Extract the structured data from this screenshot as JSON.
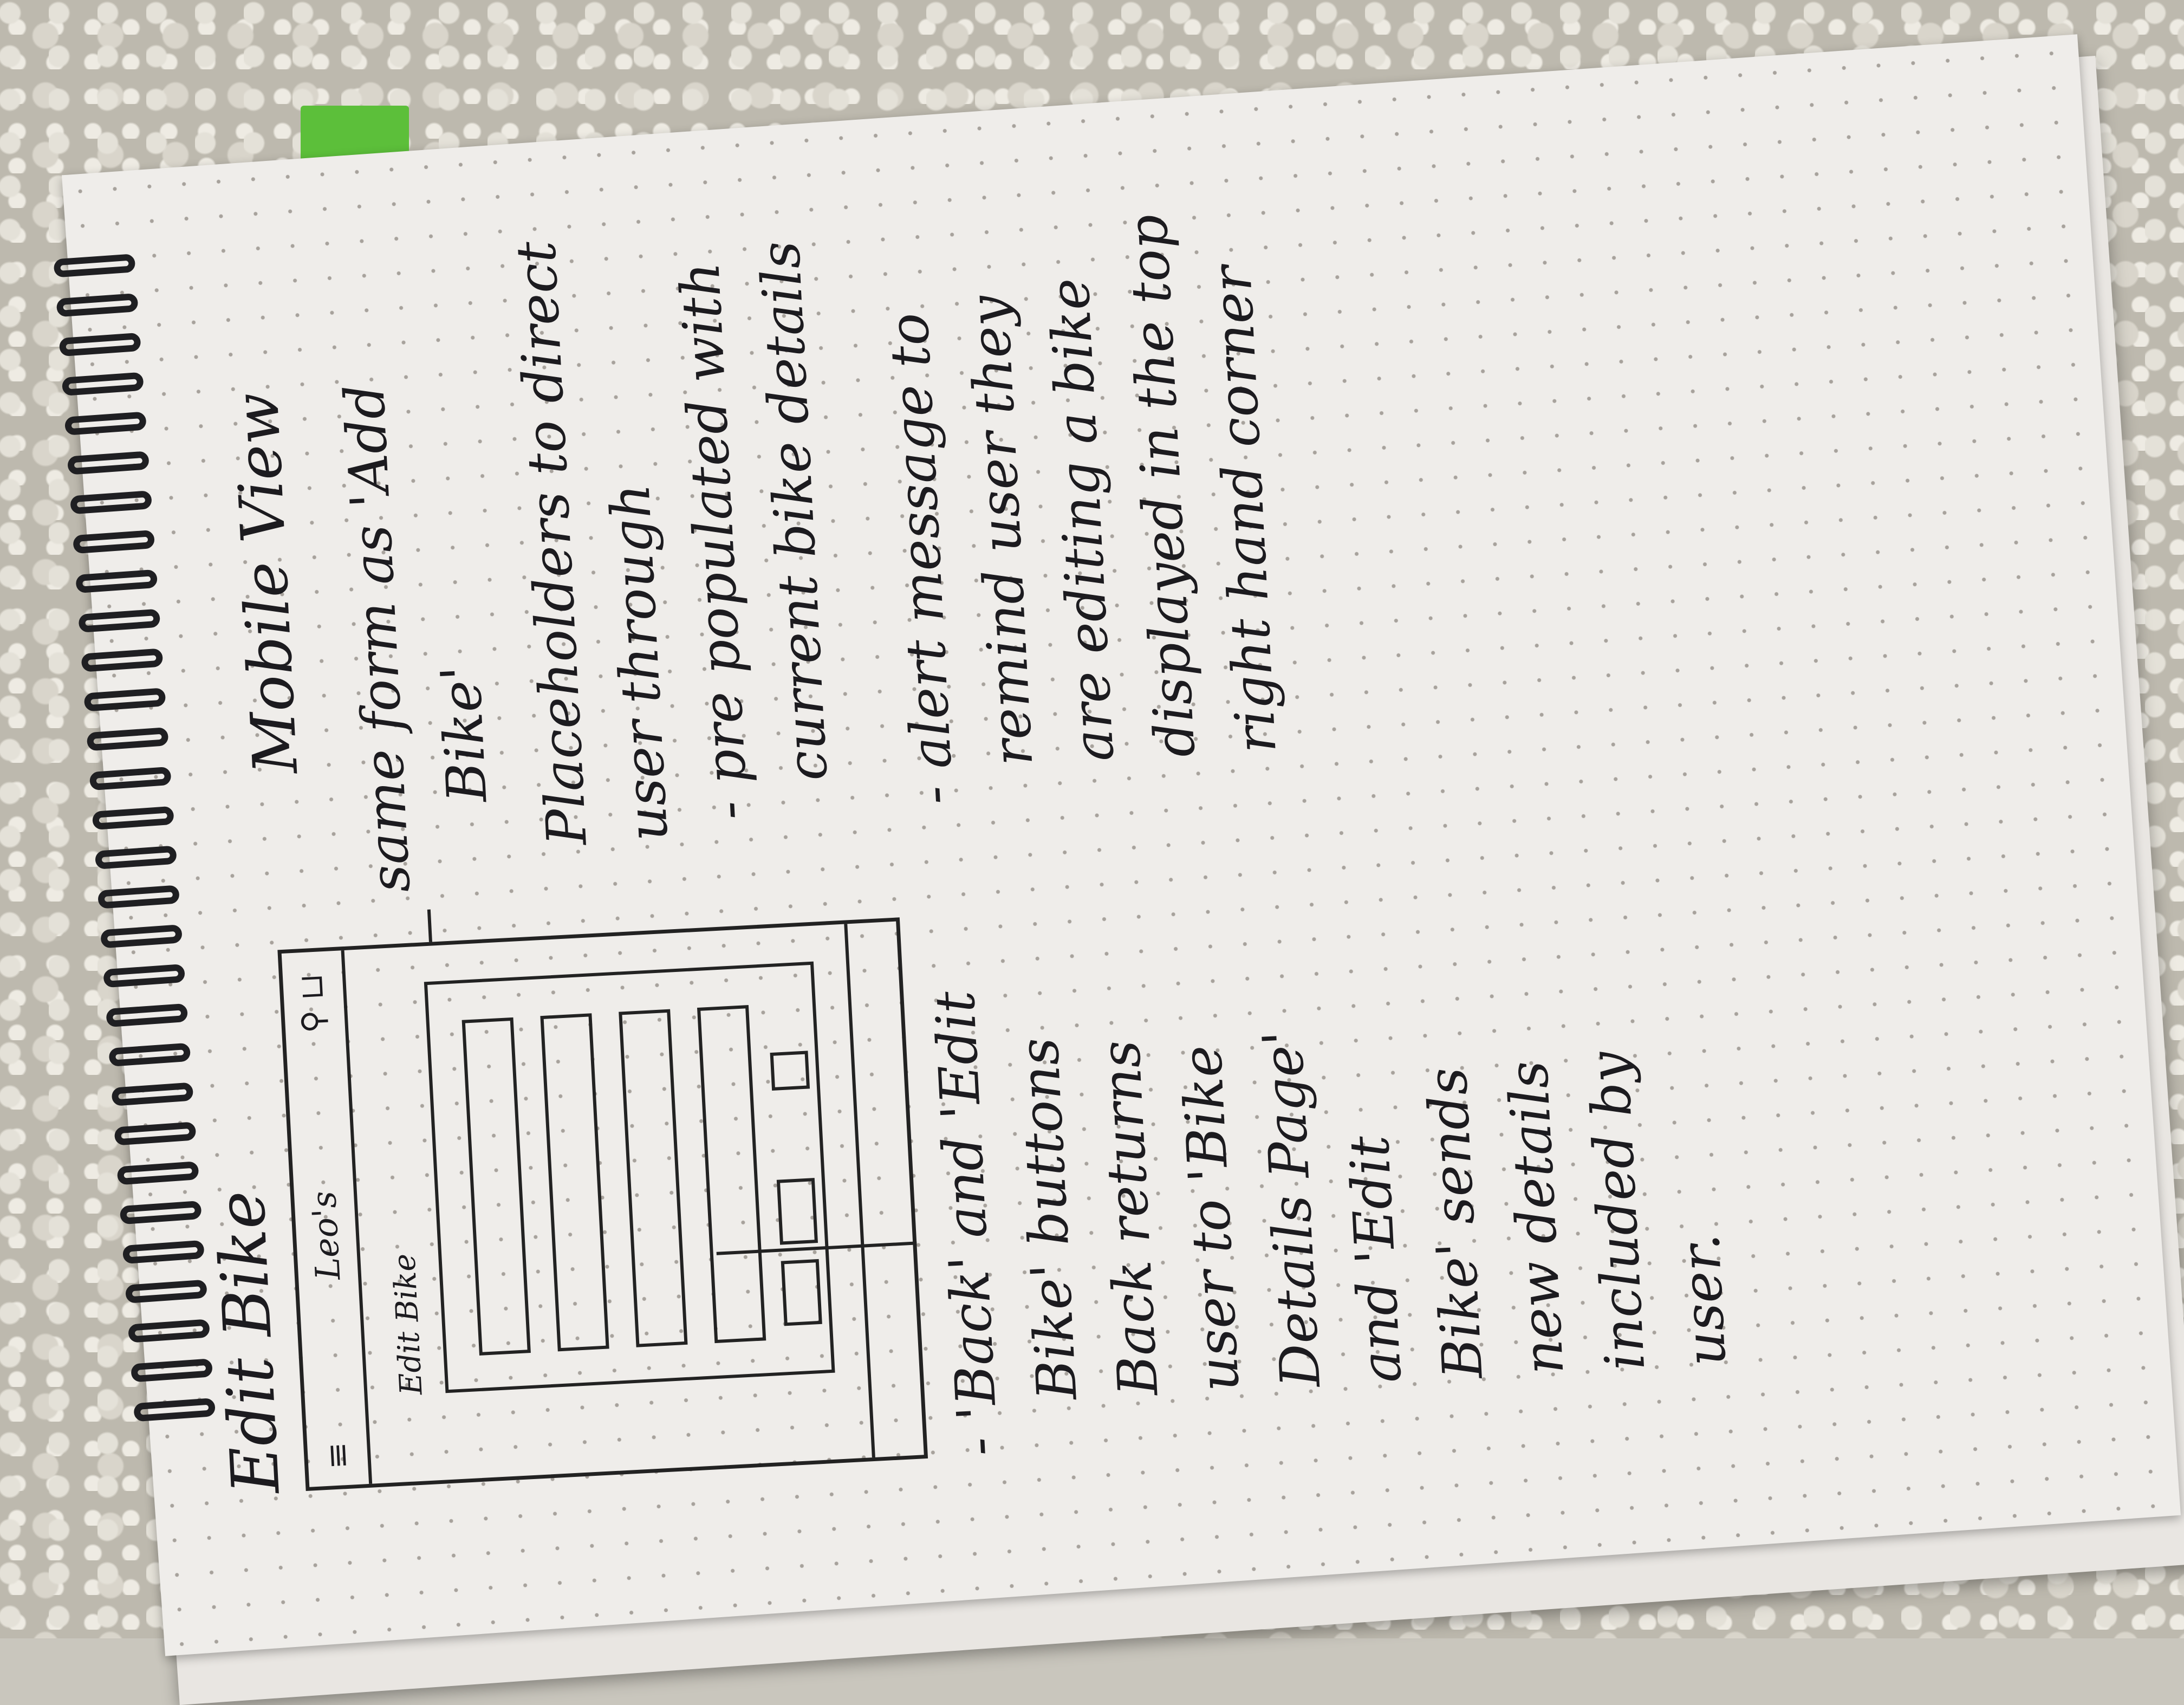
{
  "page_title": "Edit Bike",
  "subtitle": "Mobile View",
  "wireframe": {
    "menu_icon": "hamburger-icon",
    "brand": "Leo's",
    "header_icons": "person-icon cart-icon",
    "form_title": "Edit Bike"
  },
  "notes": {
    "form_note": "same form as 'Add\n     Bike'",
    "placeholder_note": "Placeholders to direct\nuser through\n - pre populated with\n   current bike details",
    "buttons_note": "- 'Back' and 'Edit\n   Bike' buttons\n   Back returns\n   user to 'Bike\n   Details Page'\n   and 'Edit\n   Bike' sends\n   new details\n   included by\n   user.",
    "alert_note": "- alert message to\n  remind user they\n  are editing a bike\n  displayed in the top\n  right hand corner"
  }
}
